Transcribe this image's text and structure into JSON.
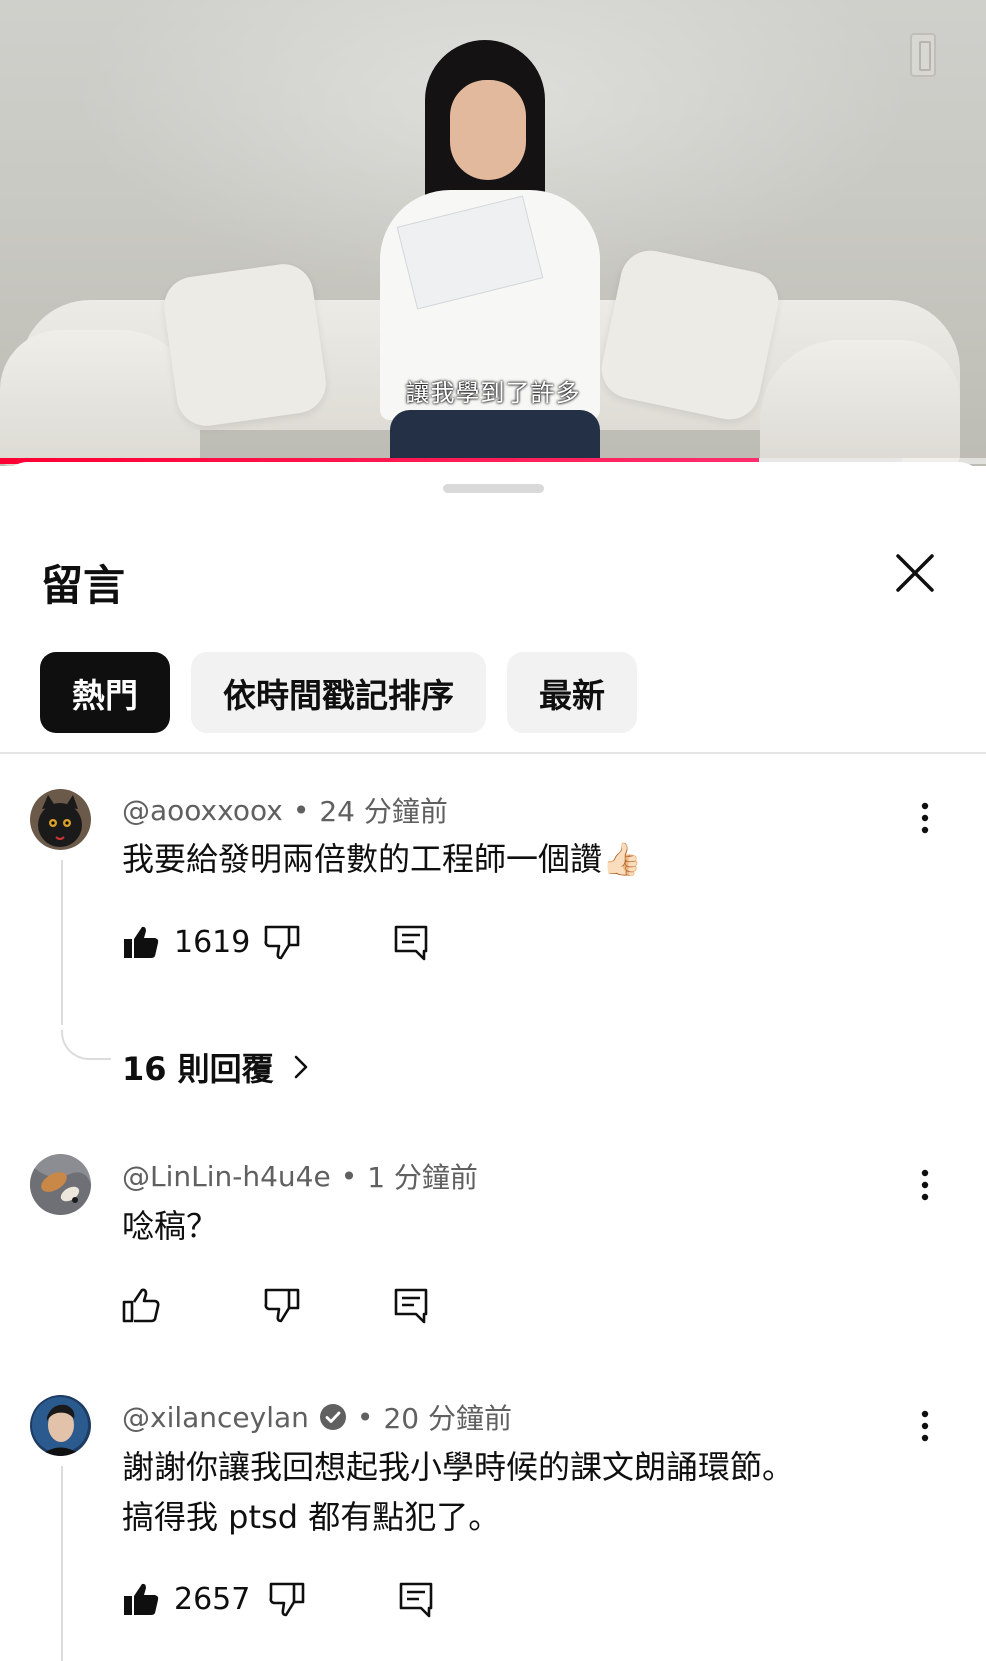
{
  "video": {
    "caption": "讓我學到了許多",
    "progress": 0.77,
    "buffered": 0.915
  },
  "sheet": {
    "title": "留言",
    "close_icon": "close-icon",
    "sort_chips": [
      {
        "label": "熱門",
        "active": true
      },
      {
        "label": "依時間戳記排序",
        "active": false
      },
      {
        "label": "最新",
        "active": false
      }
    ]
  },
  "comments": [
    {
      "handle": "@aooxxoox",
      "time": "24 分鐘前",
      "text": "我要給發明兩倍數的工程師一個讚👍🏻",
      "likes": "1619",
      "liked": true,
      "replies_label": "16 則回覆"
    },
    {
      "handle": "@LinLin-h4u4e",
      "time": "1 分鐘前",
      "text": "唸稿？",
      "likes": "",
      "liked": false
    },
    {
      "handle": "@xilanceylan",
      "verified": true,
      "time": "20 分鐘前",
      "text_line1": "謝謝你讓我回想起我小學時候的課文朗誦環節。",
      "text_line2": "搞得我 ptsd 都有點犯了。",
      "likes": "2657",
      "liked": true
    }
  ],
  "colors": {
    "progress": "#ff0033",
    "chip_active_bg": "#0f0f0f",
    "chip_bg": "#f2f2f2",
    "meta_text": "#606060"
  }
}
